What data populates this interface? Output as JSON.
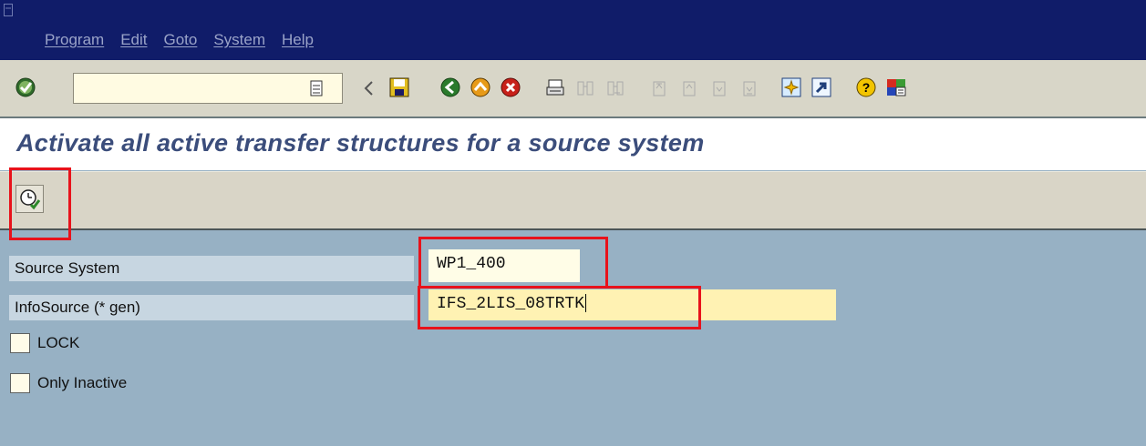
{
  "menubar": {
    "items": [
      "Program",
      "Edit",
      "Goto",
      "System",
      "Help"
    ]
  },
  "toolbar": {
    "command_field_value": "",
    "icons": [
      "enter-icon",
      "command-field-dropdown-icon",
      "back-arrow-icon",
      "save-icon",
      "back-icon",
      "exit-icon",
      "cancel-icon",
      "print-icon",
      "find-icon",
      "find-next-icon",
      "first-page-icon",
      "previous-page-icon",
      "next-page-icon",
      "last-page-icon",
      "create-session-icon",
      "shortcut-icon",
      "help-icon",
      "customize-layout-icon"
    ]
  },
  "page": {
    "title": "Activate all active transfer structures for a source system"
  },
  "app_toolbar": {
    "execute_icon": "execute-icon"
  },
  "form": {
    "source_system": {
      "label": "Source System",
      "value": "WP1_400"
    },
    "infosource": {
      "label": "InfoSource (* gen)",
      "value": "IFS_2LIS_08TRTK"
    },
    "lock": {
      "label": "LOCK",
      "checked": false
    },
    "only_inactive": {
      "label": "Only Inactive",
      "checked": false
    }
  },
  "colors": {
    "menubar": "#101c69",
    "toolbar": "#d8d6c8",
    "title": "#3b4d7b",
    "screen_bg": "#97b1c4",
    "highlight": "#e8121b"
  }
}
